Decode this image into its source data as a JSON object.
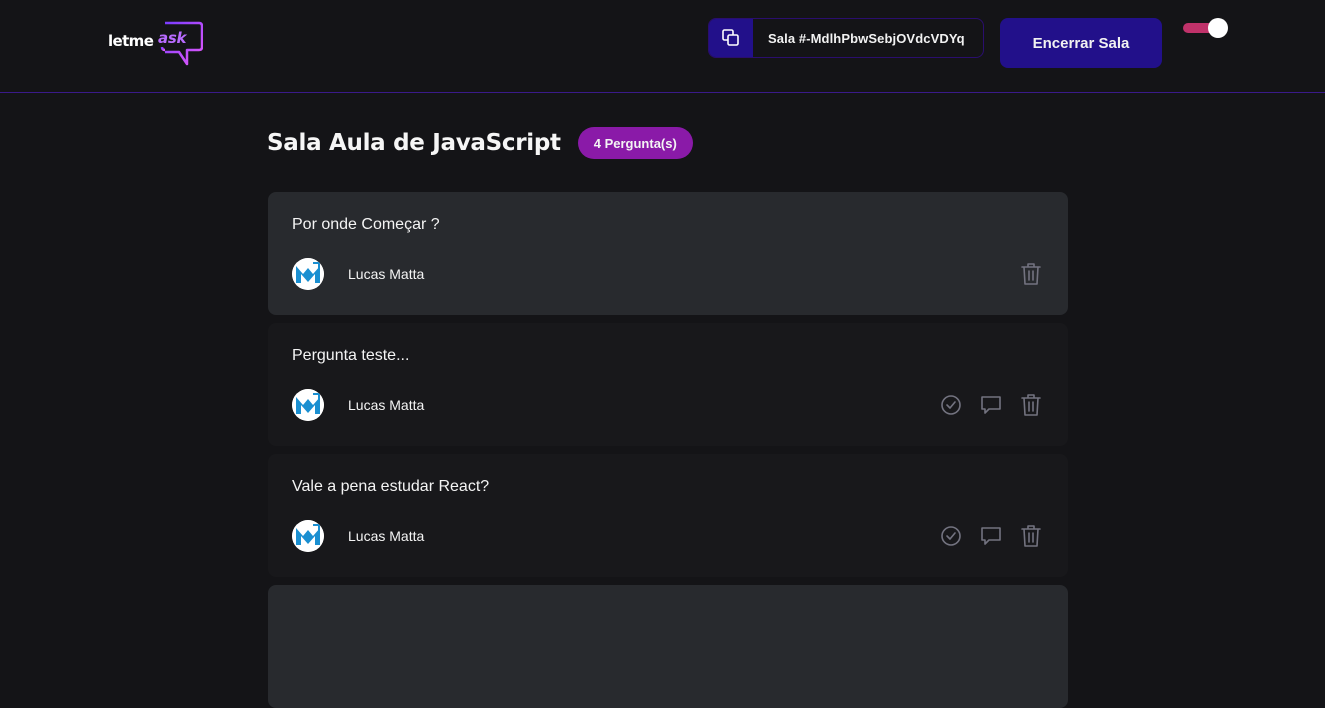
{
  "header": {
    "logo": {
      "part1": "letme",
      "part2": "ask"
    },
    "room_code": {
      "label": "Sala #-MdlhPbwSebjOVdcVDYq",
      "icon": "copy-icon"
    },
    "close_button_label": "Encerrar Sala",
    "theme_toggle": {
      "on": true,
      "accent": "#c0326a"
    }
  },
  "room": {
    "title": "Sala Aula de JavaScript",
    "count_label": "4 Pergunta(s)"
  },
  "questions": [
    {
      "text": "Por onde Começar ?",
      "author": "Lucas Matta",
      "highlighted": true,
      "actions": [
        "delete-icon"
      ]
    },
    {
      "text": "Pergunta teste...",
      "author": "Lucas Matta",
      "highlighted": false,
      "actions": [
        "check-icon",
        "answer-icon",
        "delete-icon"
      ]
    },
    {
      "text": "Vale a pena estudar React?",
      "author": "Lucas Matta",
      "highlighted": false,
      "actions": [
        "check-icon",
        "answer-icon",
        "delete-icon"
      ]
    },
    {
      "text": "",
      "author": "",
      "highlighted": true,
      "actions": []
    }
  ],
  "colors": {
    "background": "#141417",
    "primary": "#22108a",
    "badge": "#8a1aa8",
    "highlight_card": "#282a2e",
    "card": "#18181b",
    "icon": "#737380"
  }
}
